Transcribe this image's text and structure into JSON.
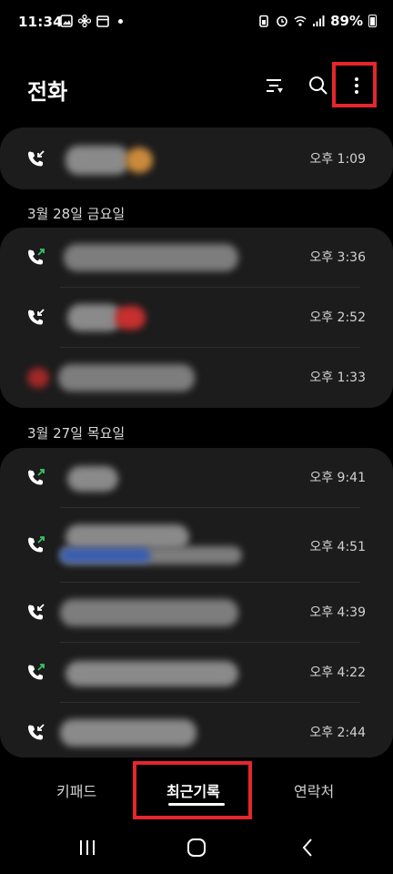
{
  "status_bar": {
    "time": "11:34",
    "battery": "89%"
  },
  "header": {
    "title": "전화"
  },
  "sections": [
    {
      "date": "",
      "calls": [
        {
          "type": "incoming",
          "time": "오후 1:09"
        }
      ]
    },
    {
      "date": "3월 28일 금요일",
      "calls": [
        {
          "type": "outgoing",
          "time": "오후 3:36"
        },
        {
          "type": "incoming",
          "time": "오후 2:52"
        },
        {
          "type": "none",
          "time": "오후 1:33"
        }
      ]
    },
    {
      "date": "3월 27일 목요일",
      "calls": [
        {
          "type": "outgoing",
          "time": "오후 9:41"
        },
        {
          "type": "outgoing",
          "time": "오후 4:51"
        },
        {
          "type": "incoming",
          "time": "오후 4:39"
        },
        {
          "type": "outgoing",
          "time": "오후 4:22"
        },
        {
          "type": "incoming",
          "time": "오후 2:44"
        }
      ]
    }
  ],
  "tabs": {
    "keypad": "키패드",
    "recents": "최근기록",
    "contacts": "연락처"
  },
  "colors": {
    "highlight": "#e5262d",
    "incoming_icon": "#ffffff",
    "outgoing_icon": "#39c36a",
    "card_bg": "#1c1c1c"
  },
  "icons": {
    "incoming": "incoming-call-icon",
    "outgoing": "outgoing-call-icon",
    "filter": "filter-icon",
    "search": "search-icon",
    "more": "more-options-icon"
  }
}
